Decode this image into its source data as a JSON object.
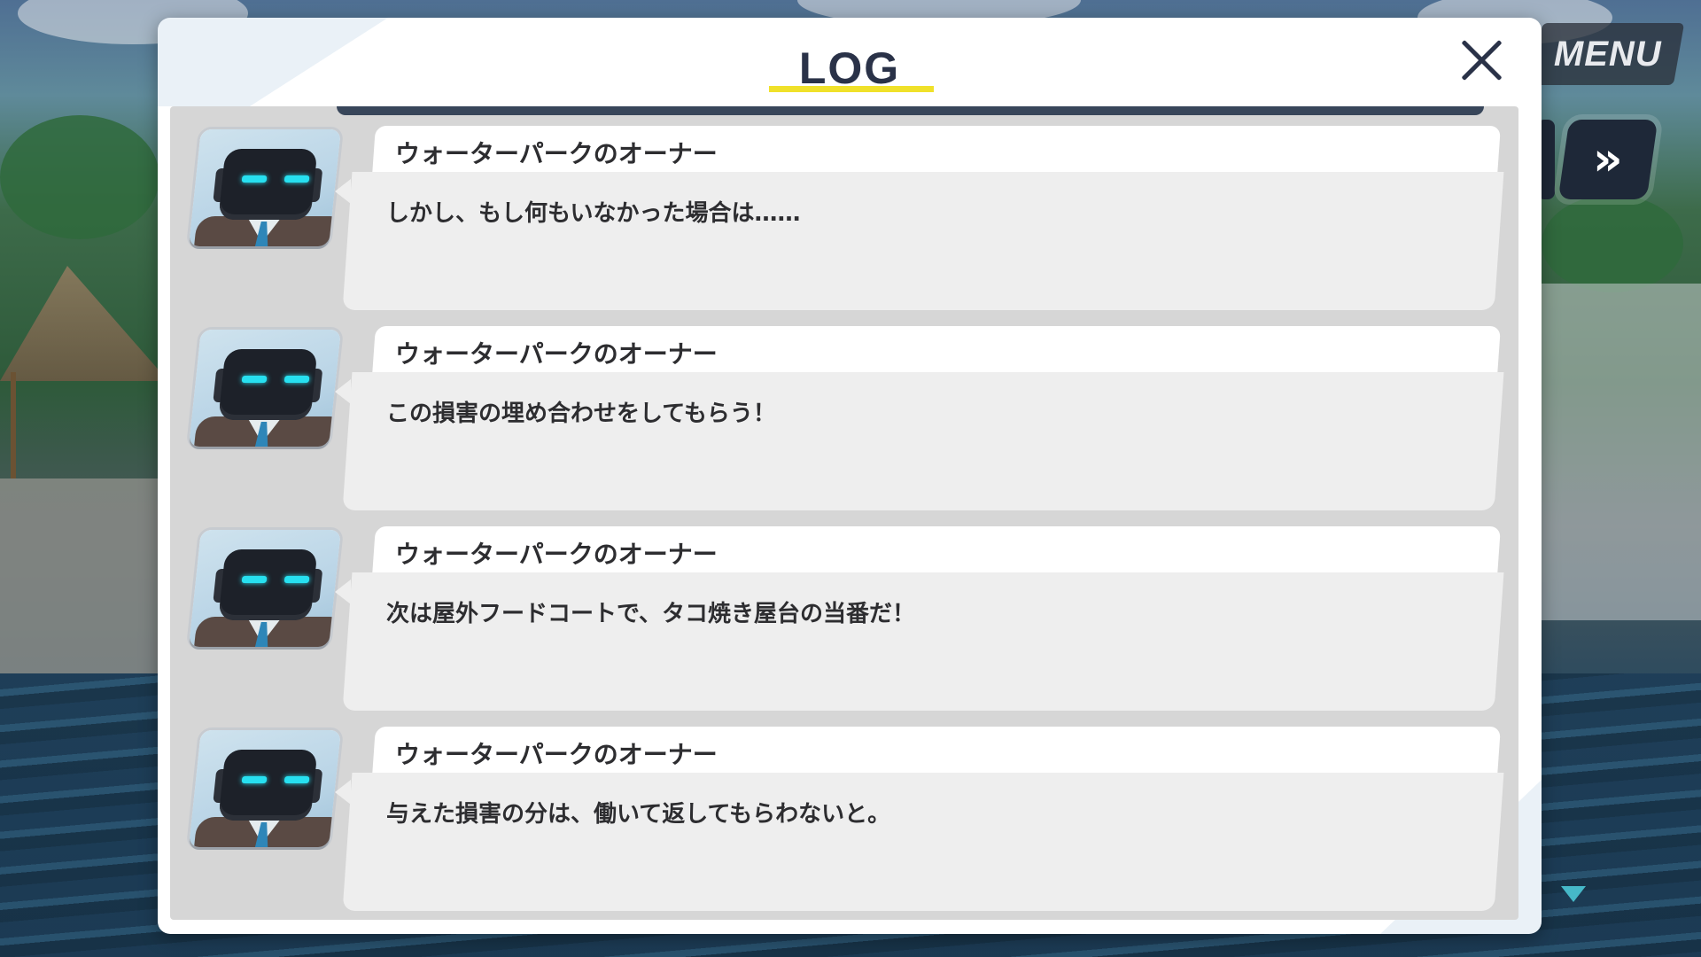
{
  "hud": {
    "menu_label": "MENU",
    "skip_label": "»"
  },
  "log": {
    "title": "LOG",
    "entries": [
      {
        "speaker": "ウォーターパークのオーナー",
        "message": "しかし、もし何もいなかった場合は……"
      },
      {
        "speaker": "ウォーターパークのオーナー",
        "message": "この損害の埋め合わせをしてもらう！"
      },
      {
        "speaker": "ウォーターパークのオーナー",
        "message": "次は屋外フードコートで、タコ焼き屋台の当番だ！"
      },
      {
        "speaker": "ウォーターパークのオーナー",
        "message": "与えた損害の分は、働いて返してもらわないと。"
      }
    ]
  },
  "colors": {
    "accent_underline": "#f0e12a",
    "title_text": "#2a3248",
    "robot_eye": "#27e0f0",
    "scroll_arrow": "#46b8c8"
  },
  "icons": {
    "close": "close-icon",
    "skip": "fast-forward-icon",
    "scroll": "triangle-down-icon"
  }
}
